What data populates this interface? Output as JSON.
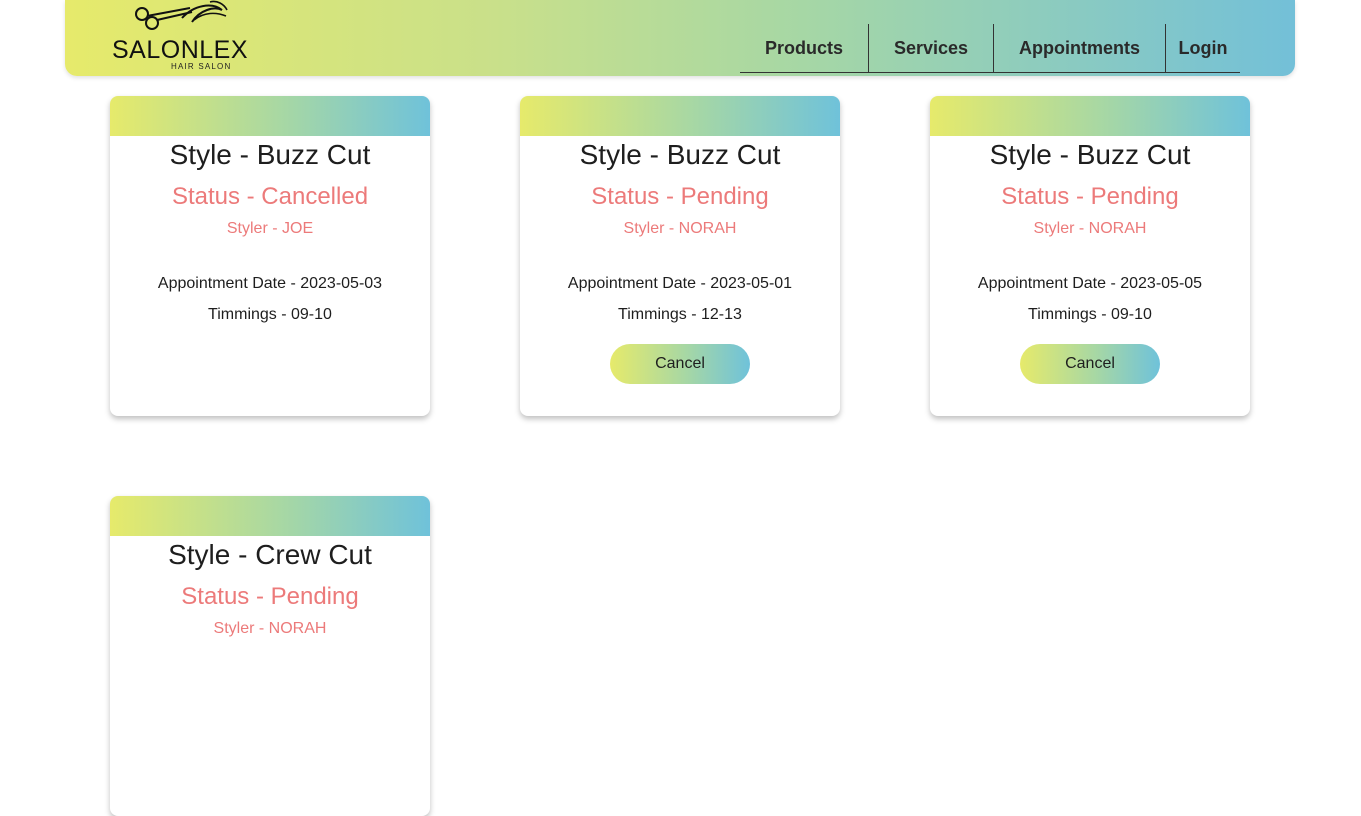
{
  "header": {
    "logo_name": "SALONLEX",
    "logo_sub": "HAIR SALON",
    "nav": [
      "Products",
      "Services",
      "Appointments",
      "Login"
    ]
  },
  "appointments": [
    {
      "style": "Style - Buzz Cut",
      "status": "Status - Cancelled",
      "styler": "Styler - JOE",
      "date": "Appointment Date - 2023-05-03",
      "timings": "Timmings - 09-10"
    },
    {
      "style": "Style - Buzz Cut",
      "status": "Status - Pending",
      "styler": "Styler - NORAH",
      "date": "Appointment Date - 2023-05-01",
      "timings": "Timmings - 12-13",
      "cancel_label": "Cancel"
    },
    {
      "style": "Style - Buzz Cut",
      "status": "Status - Pending",
      "styler": "Styler - NORAH",
      "date": "Appointment Date - 2023-05-05",
      "timings": "Timmings - 09-10",
      "cancel_label": "Cancel"
    },
    {
      "style": "Style - Crew Cut",
      "status": "Status - Pending",
      "styler": "Styler - NORAH"
    }
  ],
  "colors": {
    "status_text": "#ec7a7a",
    "gradient_start": "#e6ea6b",
    "gradient_end": "#6fc2da"
  },
  "icons": [
    "scissors-logo-icon"
  ]
}
